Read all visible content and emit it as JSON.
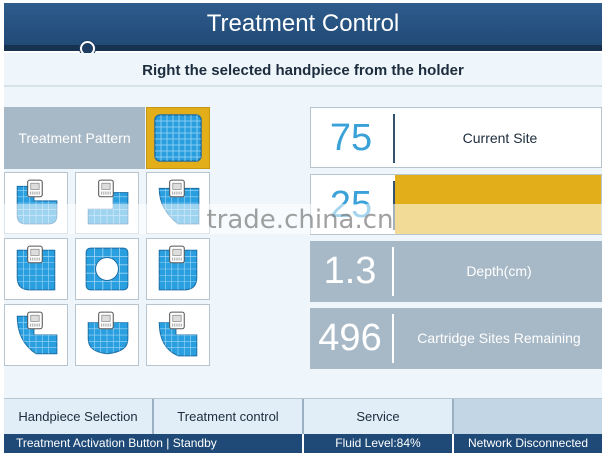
{
  "header": {
    "title": "Treatment Control"
  },
  "instruction": "Right the selected handpiece from the holder",
  "pattern": {
    "title": "Treatment Pattern",
    "cells": [
      {
        "name": "pattern-upper-left"
      },
      {
        "name": "pattern-upper-middle"
      },
      {
        "name": "pattern-upper-right"
      },
      {
        "name": "pattern-left-half"
      },
      {
        "name": "pattern-center-circle"
      },
      {
        "name": "pattern-right-half"
      },
      {
        "name": "pattern-lower-left"
      },
      {
        "name": "pattern-lower-middle"
      },
      {
        "name": "pattern-lower-right"
      }
    ]
  },
  "info": {
    "site_value": "75",
    "site_label": "Current Site",
    "energy_value": "25",
    "depth_value": "1.3",
    "depth_label": "Depth(cm)",
    "cartridge_value": "496",
    "cartridge_label": "Cartridge Sites Remaining"
  },
  "watermark": "trade.china.cn",
  "nav": {
    "handpiece": "Handpiece Selection",
    "treatment": "Treatment control",
    "service": "Service"
  },
  "status": {
    "activation": "Treatment Activation Button | Standby",
    "fluid": "Fluid Level:84%",
    "network": "Network Disconnected"
  },
  "colors": {
    "header": "#214a77",
    "accent_yellow": "#e2ae1a",
    "value_blue": "#3aa2d8",
    "panel_gray": "#a7b8c6",
    "pattern_blue": "#2a9fe0"
  }
}
